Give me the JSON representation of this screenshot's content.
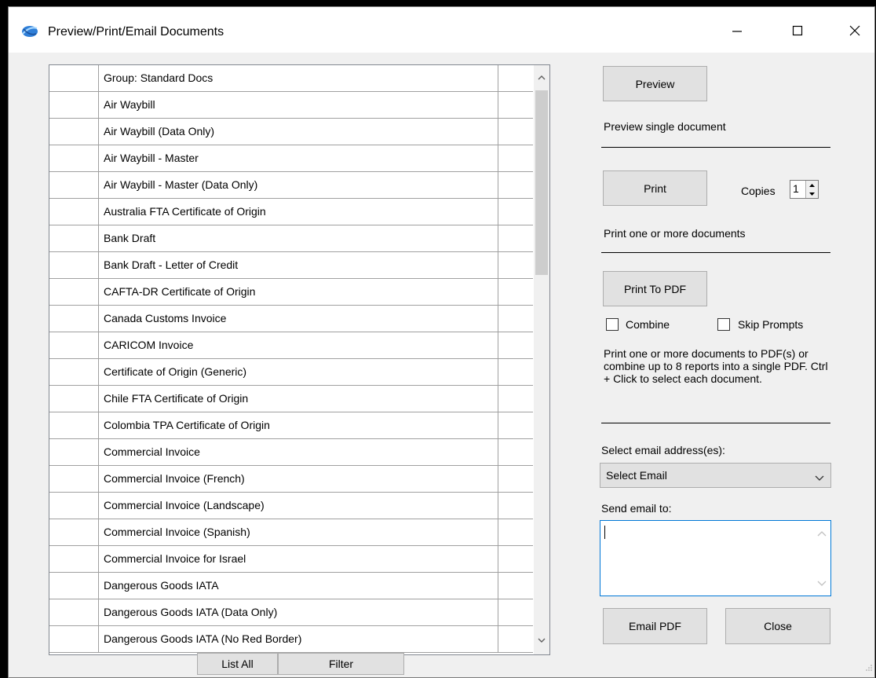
{
  "window": {
    "title": "Preview/Print/Email Documents"
  },
  "documents": [
    "Group: Standard Docs",
    "Air Waybill",
    "Air Waybill  (Data Only)",
    "Air Waybill - Master",
    "Air Waybill - Master (Data Only)",
    "Australia FTA Certificate of Origin",
    "Bank Draft",
    "Bank Draft - Letter of Credit",
    "CAFTA-DR Certificate of Origin",
    "Canada Customs Invoice",
    "CARICOM Invoice",
    "Certificate of Origin (Generic)",
    "Chile FTA Certificate of Origin",
    "Colombia TPA Certificate of Origin",
    "Commercial Invoice",
    "Commercial Invoice (French)",
    "Commercial Invoice (Landscape)",
    "Commercial Invoice (Spanish)",
    "Commercial Invoice for Israel",
    "Dangerous Goods IATA",
    "Dangerous Goods IATA (Data Only)",
    "Dangerous Goods IATA (No Red Border)"
  ],
  "list_buttons": {
    "list_all": "List All",
    "filter": "Filter"
  },
  "preview": {
    "button": "Preview",
    "description": "Preview single document"
  },
  "print": {
    "button": "Print",
    "copies_label": "Copies",
    "copies_value": "1",
    "description": "Print one or more documents"
  },
  "pdf": {
    "button": "Print To PDF",
    "combine_label": "Combine",
    "skip_prompts_label": "Skip Prompts",
    "description": "Print one or more documents to PDF(s) or combine up to 8 reports into a single PDF. Ctrl + Click to select each document."
  },
  "email": {
    "select_label": "Select email address(es):",
    "select_value": "Select Email",
    "send_to_label": "Send email to:",
    "send_to_value": "",
    "email_button": "Email PDF",
    "close_button": "Close"
  },
  "icons": {
    "app": "globe-icon",
    "minimize": "minimize-icon",
    "maximize": "maximize-icon",
    "close": "close-icon"
  },
  "colors": {
    "focus_border": "#0078d7",
    "button_face": "#e1e1e1",
    "window_bg": "#f0f0f0"
  }
}
